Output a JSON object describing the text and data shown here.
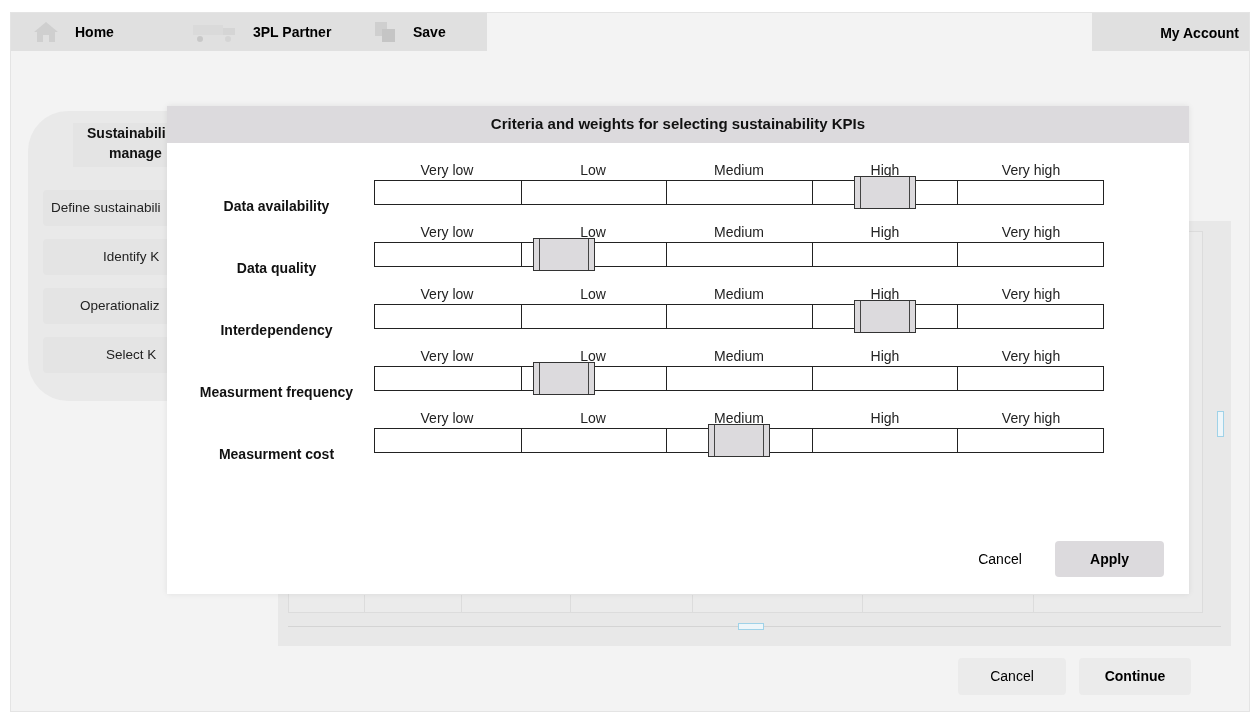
{
  "nav": {
    "items": [
      "Home",
      "3PL Partner",
      "Save"
    ],
    "account": "My Account"
  },
  "sidebar": {
    "title_lines": [
      "Sustainabili",
      "manage"
    ],
    "items": [
      "Define sustainabili",
      "Identify K",
      "Operationaliz",
      "Select K"
    ]
  },
  "dialog": {
    "title": "Criteria and weights for selecting sustainability KPIs",
    "criteria": [
      {
        "name": "Data availability",
        "scale": [
          "Very low",
          "Low",
          "Medium",
          "High",
          "Very high"
        ],
        "level": 0.7
      },
      {
        "name": "Data quality",
        "scale": [
          "Very low",
          "Low",
          "Medium",
          "High",
          "Very high"
        ],
        "level": 0.26
      },
      {
        "name": "Interdependency",
        "scale": [
          "Very low",
          "Low",
          "Medium",
          "High",
          "Very high"
        ],
        "level": 0.7
      },
      {
        "name": "Measurment frequency",
        "scale": [
          "Very low",
          "Low",
          "Medium",
          "High",
          "Very high"
        ],
        "level": 0.26
      },
      {
        "name": "Measurment cost",
        "scale": [
          "Very low",
          "Low",
          "Medium",
          "High",
          "Very high"
        ],
        "level": 0.5
      }
    ],
    "buttons": [
      {
        "label": "Cancel",
        "kind": "plain"
      },
      {
        "label": "Apply",
        "kind": "primary"
      }
    ]
  },
  "footer_buttons": [
    "Cancel",
    "Continue"
  ]
}
